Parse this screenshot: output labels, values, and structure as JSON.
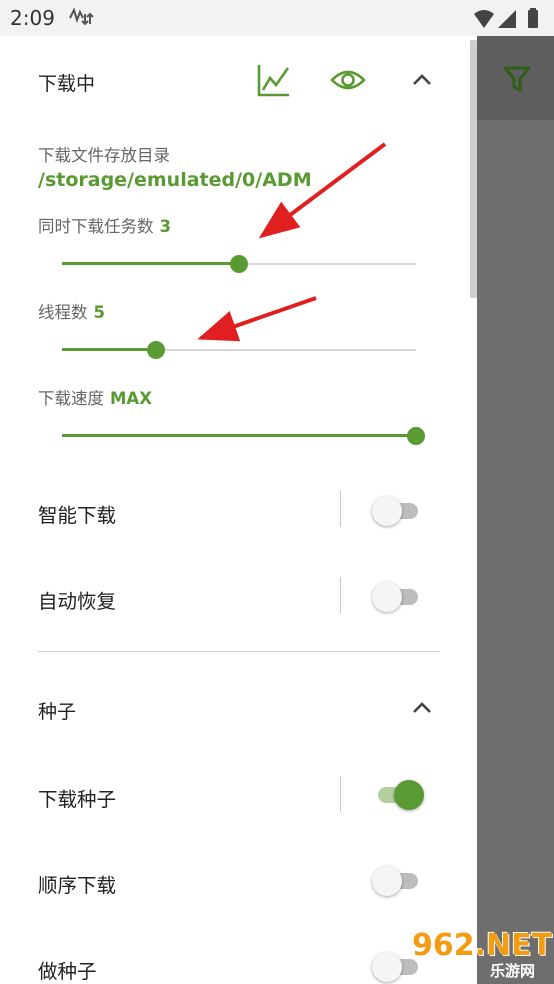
{
  "status_bar": {
    "time": "2:09"
  },
  "download_section": {
    "title": "下载中",
    "dir_label": "下载文件存放目录",
    "dir_path": "/storage/emulated/0/ADM",
    "concurrent_label": "同时下载任务数",
    "concurrent_value": "3",
    "concurrent_fraction": 0.5,
    "threads_label": "线程数",
    "threads_value": "5",
    "threads_fraction": 0.265,
    "speed_label": "下载速度",
    "speed_value": "MAX",
    "speed_fraction": 1.0,
    "toggles": [
      {
        "label": "智能下载",
        "on": false
      },
      {
        "label": "自动恢复",
        "on": false
      }
    ]
  },
  "torrent_section": {
    "title": "种子",
    "toggles": [
      {
        "label": "下载种子",
        "on": true
      },
      {
        "label": "顺序下载",
        "on": false
      },
      {
        "label": "做种子",
        "on": false
      }
    ]
  },
  "watermark": {
    "main": "962.NET",
    "sub": "乐游网"
  },
  "colors": {
    "accent": "#5a9a32",
    "arrow": "#e02020",
    "scrim": "#6e6e6e"
  },
  "icons": [
    "network-activity-icon",
    "wifi-icon",
    "signal-icon",
    "battery-icon",
    "chart-icon",
    "eye-icon",
    "chevron-up-icon",
    "filter-icon"
  ]
}
